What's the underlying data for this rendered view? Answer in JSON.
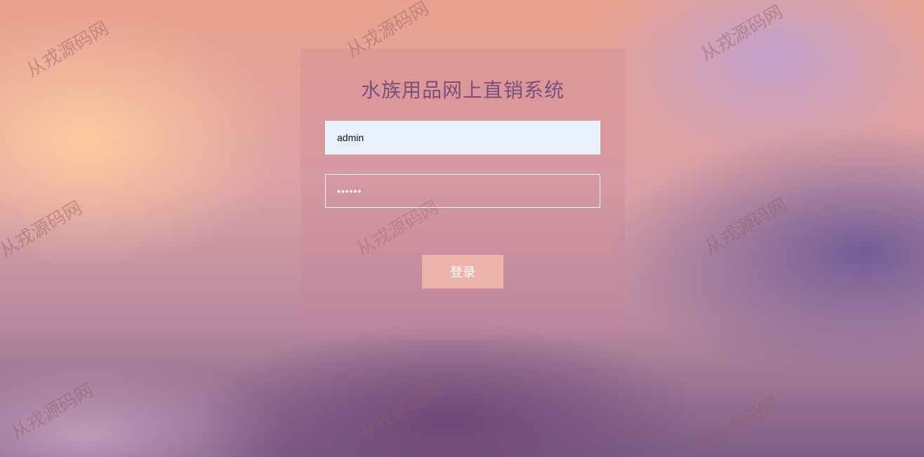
{
  "watermark": "从戎源码网",
  "login": {
    "title": "水族用品网上直销系统",
    "username_value": "admin",
    "password_value": "••••••",
    "submit_label": "登录"
  }
}
